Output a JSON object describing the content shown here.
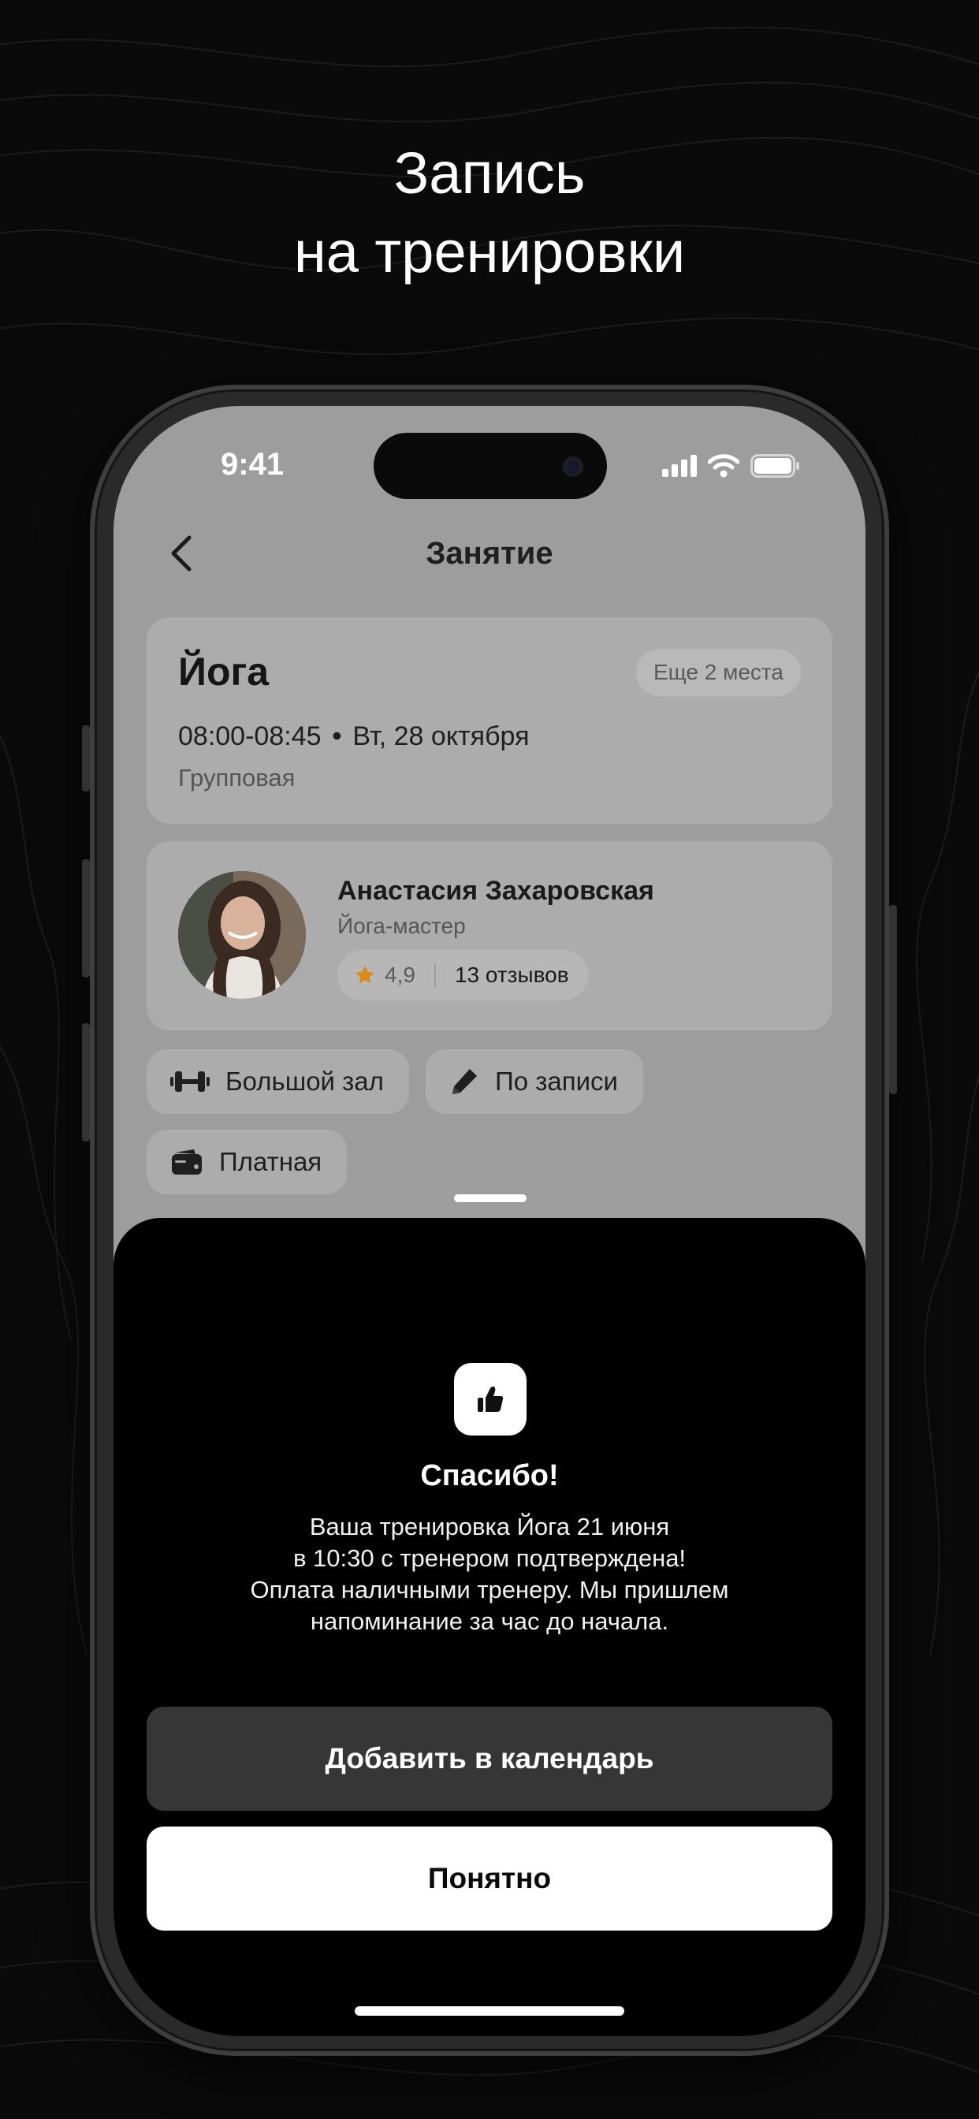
{
  "headline": {
    "line1": "Запись",
    "line2": "на тренировки"
  },
  "status_bar": {
    "time": "9:41"
  },
  "header": {
    "title": "Занятие"
  },
  "class_card": {
    "name": "Йога",
    "spots_badge": "Еще 2 места",
    "time": "08:00-08:45",
    "date": "Вт, 28 октября",
    "type": "Групповая"
  },
  "trainer_card": {
    "name": "Анастасия Захаровская",
    "role": "Йога-мастер",
    "rating": "4,9",
    "reviews": "13 отзывов"
  },
  "chips": {
    "hall": "Большой зал",
    "signup": "По записи",
    "paid": "Платная"
  },
  "sheet": {
    "title": "Спасибо!",
    "text_line1": "Ваша тренировка Йога 21 июня",
    "text_line2": "в 10:30 с тренером подтверждена!",
    "text_line3": "Оплата наличными тренеру. Мы пришлем",
    "text_line4": "напоминание за час до начала.",
    "calendar_button": "Добавить в календарь",
    "ok_button": "Понятно"
  },
  "icons": {
    "back": "chevron-left-icon",
    "signal": "cellular-signal-icon",
    "wifi": "wifi-icon",
    "battery": "battery-icon",
    "star": "star-icon",
    "hall": "dumbbell-icon",
    "signup": "pen-icon",
    "paid": "wallet-icon",
    "sheet": "thumbs-up-icon"
  },
  "colors": {
    "background": "#0a0a0a",
    "star": "#d98a1c",
    "sheet": "#000000",
    "secondary_button": "#363636",
    "primary_button": "#ffffff"
  }
}
